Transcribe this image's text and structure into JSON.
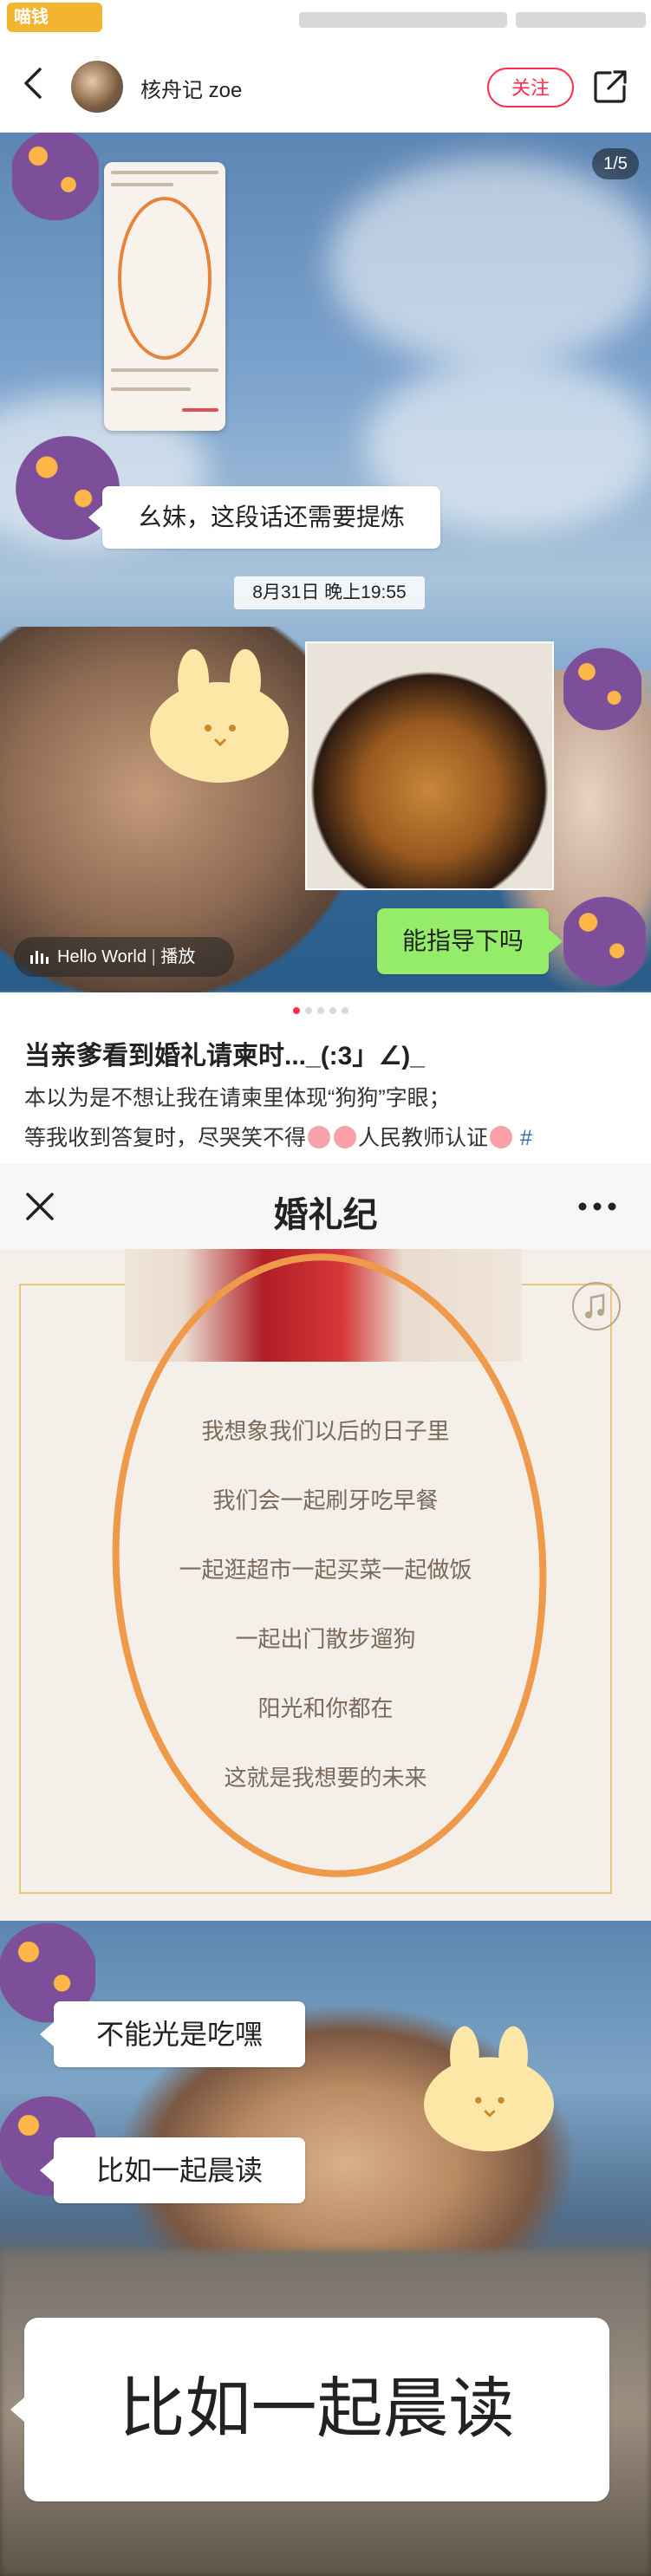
{
  "status_bar": {
    "app_logo_text": "喵钱"
  },
  "header": {
    "author_name": "核舟记 zoe",
    "follow_label": "关注"
  },
  "carousel": {
    "page_counter": "1/5",
    "chat": {
      "bubble_1": "幺妹，这段话还需要提炼",
      "timestamp": "8月31日 晚上19:55",
      "bubble_2": "能指导下吗"
    },
    "audio": {
      "title": "Hello World",
      "action": "播放"
    },
    "dots": {
      "total": 5,
      "active": 1
    }
  },
  "post": {
    "title": "当亲爹看到婚礼请柬时..._(:3」∠)_",
    "line1": "本以为是不想让我在请柬里体现“狗狗”字眼；",
    "line2": "等我收到答复时，尽哭笑不得",
    "line2_tail": "人民教师认证",
    "hashtag": "#"
  },
  "wedding_card": {
    "title": "婚礼纪",
    "poem": [
      "我想象我们以后的日子里",
      "我们会一起刷牙吃早餐",
      "一起逛超市一起买菜一起做饭",
      "一起出门散步遛狗",
      "阳光和你都在",
      "这就是我想要的未来"
    ]
  },
  "lower_photo": {
    "bubble_1": "不能光是吃嘿",
    "bubble_2": "比如一起晨读",
    "big_caption": "比如一起晨读"
  },
  "colors": {
    "accent": "#ff2e4d",
    "wechat_green": "#95ec69",
    "hashtag_blue": "#3a68b3",
    "circle_orange": "#ef9a4b"
  }
}
